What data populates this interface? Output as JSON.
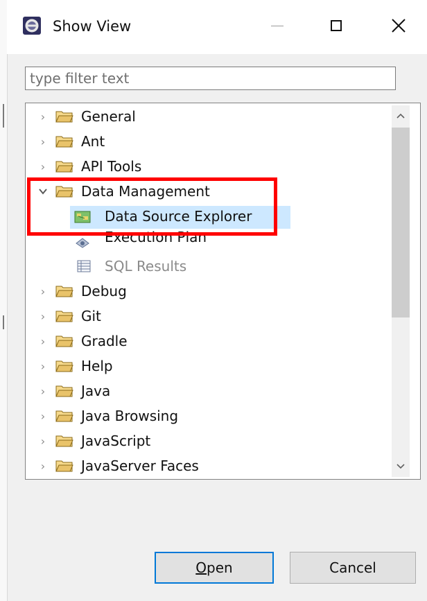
{
  "window": {
    "title": "Show View",
    "icons": {
      "app": "eclipse-icon",
      "minimize": "minimize-icon",
      "maximize": "maximize-icon",
      "close": "close-icon"
    }
  },
  "filter": {
    "placeholder": "type filter text",
    "value": ""
  },
  "tree": {
    "items": [
      {
        "label": "General",
        "type": "folder",
        "expanded": false
      },
      {
        "label": "Ant",
        "type": "folder",
        "expanded": false
      },
      {
        "label": "API Tools",
        "type": "folder",
        "expanded": false
      },
      {
        "label": "Data Management",
        "type": "folder",
        "expanded": true,
        "children": [
          {
            "label": "Data Source Explorer",
            "icon": "data-source-explorer-icon",
            "selected": true
          },
          {
            "label": "Execution Plan",
            "icon": "execution-plan-icon"
          },
          {
            "label": "SQL Results",
            "icon": "sql-results-icon",
            "disabled": true
          }
        ]
      },
      {
        "label": "Debug",
        "type": "folder",
        "expanded": false
      },
      {
        "label": "Git",
        "type": "folder",
        "expanded": false
      },
      {
        "label": "Gradle",
        "type": "folder",
        "expanded": false
      },
      {
        "label": "Help",
        "type": "folder",
        "expanded": false
      },
      {
        "label": "Java",
        "type": "folder",
        "expanded": false
      },
      {
        "label": "Java Browsing",
        "type": "folder",
        "expanded": false
      },
      {
        "label": "JavaScript",
        "type": "folder",
        "expanded": false
      },
      {
        "label": "JavaServer Faces",
        "type": "folder",
        "expanded": false
      }
    ]
  },
  "buttons": {
    "open_mnemonic": "O",
    "open_rest": "pen",
    "cancel": "Cancel"
  },
  "colors": {
    "highlight": "#ff0000",
    "selection": "#cde8ff",
    "folder": "#e3c56b",
    "button_focus": "#0078d7"
  }
}
